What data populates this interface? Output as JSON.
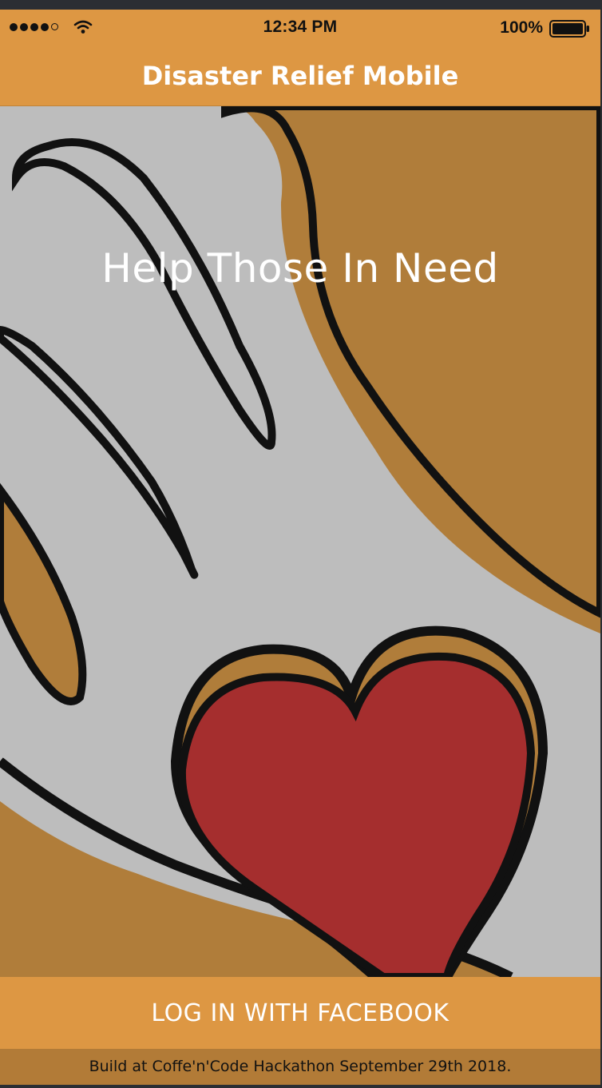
{
  "status_bar": {
    "time": "12:34 PM",
    "battery": "100%",
    "signal_icon": "signal-dots-icon",
    "wifi_icon": "wifi-icon",
    "battery_icon": "battery-full-icon"
  },
  "nav": {
    "title": "Disaster Relief Mobile"
  },
  "hero": {
    "title": "Help Those In Need",
    "image_icon": "hand-with-heart-illustration"
  },
  "login": {
    "label": "LOG IN WITH FACEBOOK"
  },
  "footer": {
    "text": "Build at Coffe'n'Code Hackathon September 29th 2018."
  },
  "colors": {
    "brand": "#dd9743",
    "hand": "#bdbdbd",
    "heart": "#a52e2e",
    "background_art": "#b07d3a"
  }
}
